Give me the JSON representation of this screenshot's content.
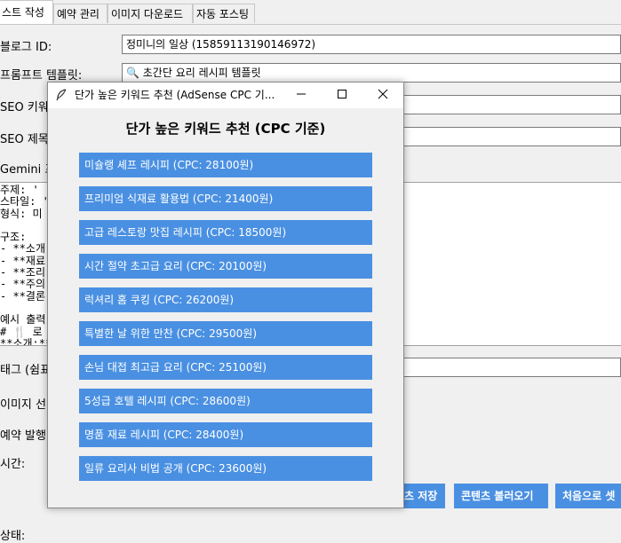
{
  "tabs": [
    {
      "label": "스트 작성"
    },
    {
      "label": "예약 관리"
    },
    {
      "label": "이미지 다운로드"
    },
    {
      "label": "자동 포스팅"
    }
  ],
  "form": {
    "blog_id_label": "블로그 ID:",
    "blog_id_value": "정미니의 일상 (15859113190146972)",
    "prompt_template_label": "프롬프트 템플릿:",
    "prompt_template_value": "🔍 초간단 요리 레시피 템플릿",
    "seo_keyword_label": "SEO 키워",
    "seo_title_label": "SEO 제목",
    "gemini_label": "Gemini 프",
    "prompt_lines": [
      "주제: '",
      "스타일: '",
      "형식: 미",
      "",
      "구조:",
      "- **소개",
      "- **재료",
      "- **조리",
      "- **주의",
      "- **결론",
      "",
      "예시 출력",
      "# 🍴 로 ",
      "**소개:**"
    ],
    "tags_label": "태그 (쉼표",
    "image_label": "이미지 선",
    "schedule_label": "예약 발행",
    "time_label": "시간:",
    "status_label": "상태:"
  },
  "bottom_buttons": {
    "save": "츠 저장",
    "load": "콘텐츠 불러오기",
    "reset": "처음으로 셋"
  },
  "dialog": {
    "title": "단가 높은 키워드 추천 (AdSense CPC 기...",
    "heading": "단가 높은 키워드 추천 (CPC 기준)",
    "keywords": [
      "미슐랭 셰프 레시피 (CPC: 28100원)",
      "프리미엄 식재료 활용법 (CPC: 21400원)",
      "고급 레스토랑 맛집 레시피 (CPC: 18500원)",
      "시간 절약 초고급 요리 (CPC: 20100원)",
      "럭셔리 홈 쿠킹 (CPC: 26200원)",
      "특별한 날 위한 만찬 (CPC: 29500원)",
      "손님 대접 최고급 요리 (CPC: 25100원)",
      "5성급 호텔 레시피 (CPC: 28600원)",
      "명품 재료 레시피 (CPC: 28400원)",
      "일류 요리사 비법 공개 (CPC: 23600원)"
    ]
  },
  "colors": {
    "accent": "#4a90e2",
    "window_bg": "#f0f0f0"
  }
}
